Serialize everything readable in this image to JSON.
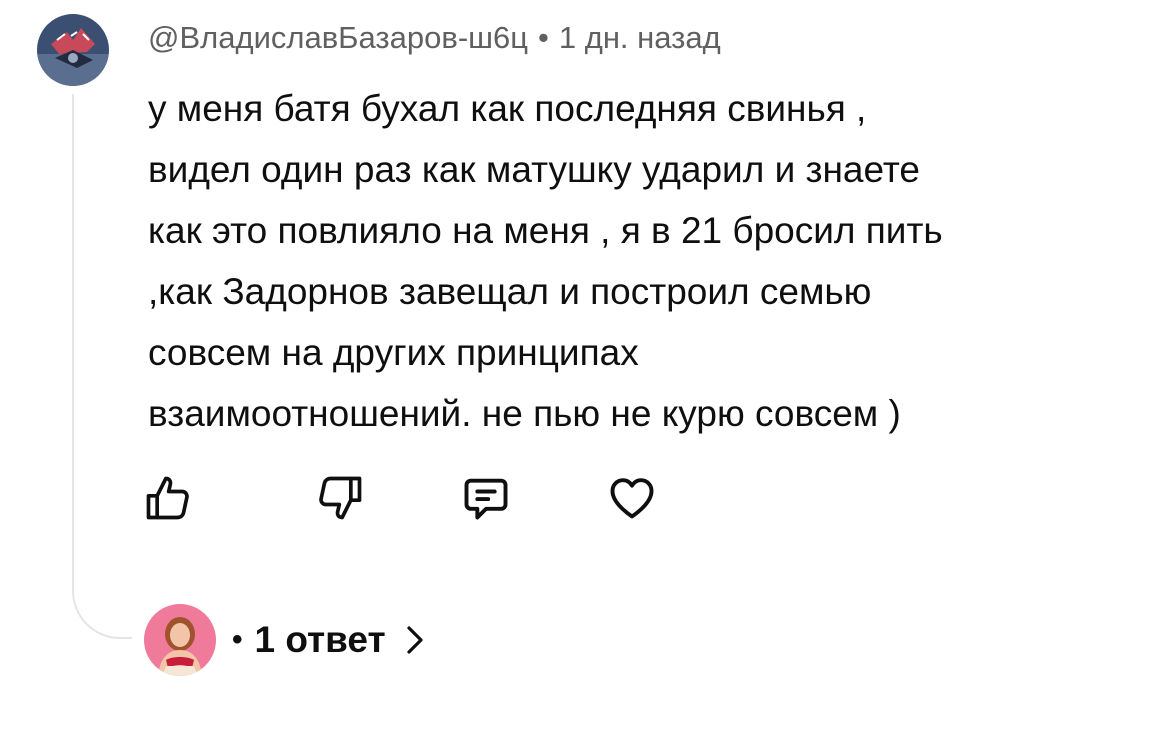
{
  "comment": {
    "author": "@ВладиславБазаров-ш6ц",
    "separator": "•",
    "time": "1 дн. назад",
    "lines": [
      "у меня батя бухал как последняя свинья ,",
      "видел один раз как матушку ударил и знаете",
      "как это повлияло на меня , я в 21 бросил пить",
      ",как Задорнов завещал и построил семью",
      "совсем на других принципах",
      "взаимоотношений. не пью не курю совсем )"
    ]
  },
  "actions": [
    "like-icon",
    "dislike-icon",
    "reply-icon",
    "heart-icon"
  ],
  "replies": {
    "dot": "•",
    "label": "1 ответ",
    "chevron": "chevron-right-icon"
  },
  "colors": {
    "text": "#0f0f0f",
    "meta": "#606060",
    "thread_line": "#e5e5e5",
    "reply_avatar_bg": "#f07a9a"
  }
}
